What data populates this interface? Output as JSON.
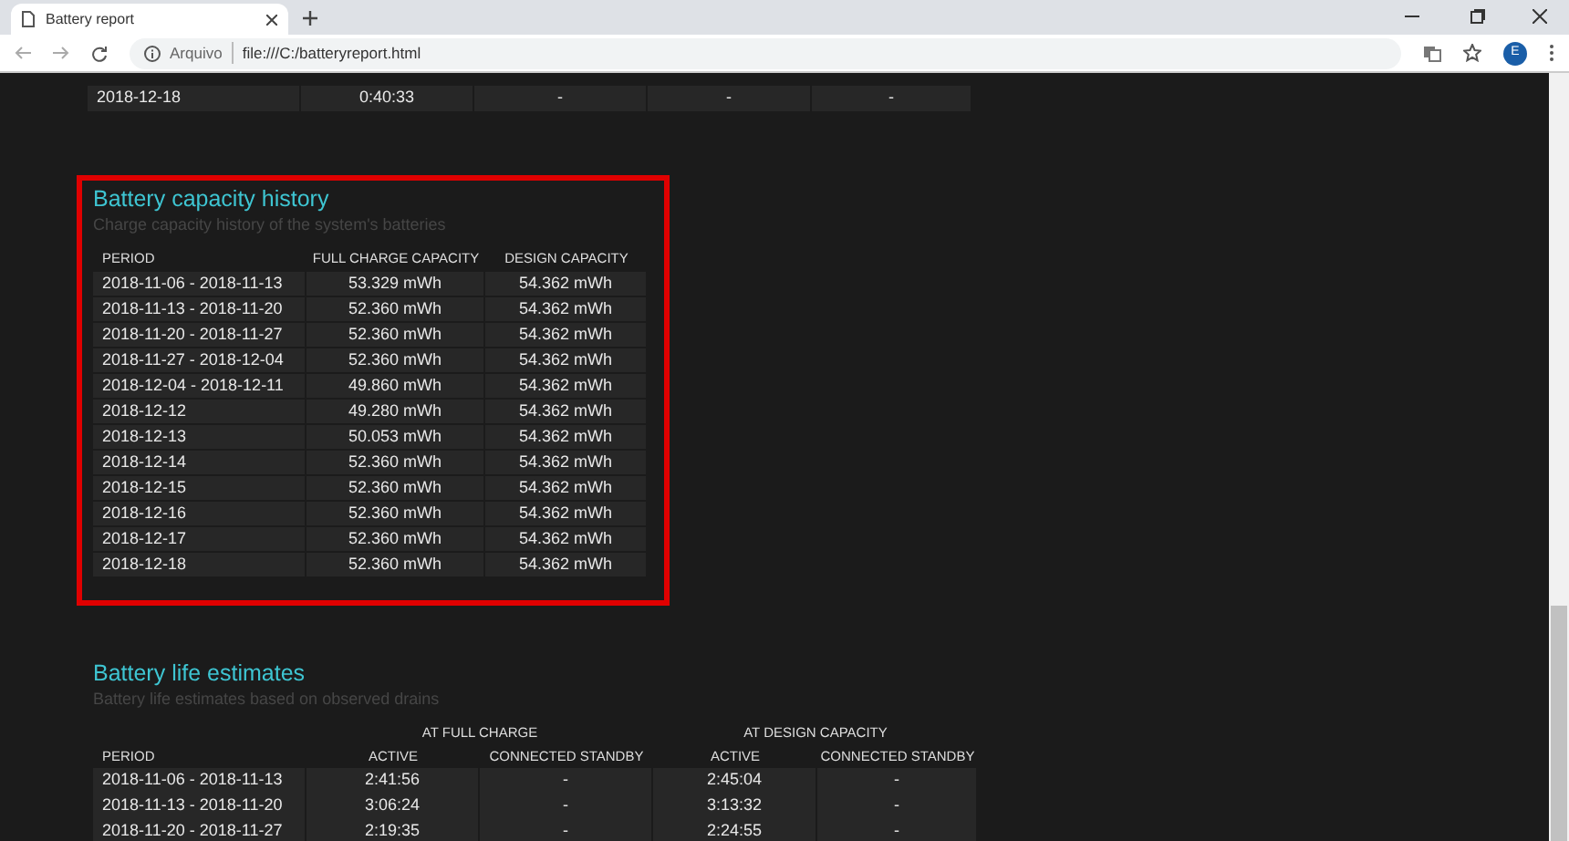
{
  "browser": {
    "tab_title": "Battery report",
    "address_prefix": "Arquivo",
    "url": "file:///C:/batteryreport.html",
    "profile_initial": "E"
  },
  "drains_table": {
    "rows": [
      [
        "2018-12-18",
        "0:40:33",
        "-",
        "-",
        "-"
      ]
    ]
  },
  "capacity_history": {
    "highlighted": true,
    "title": "Battery capacity history",
    "subtitle": "Charge capacity history of the system's batteries",
    "columns": [
      "PERIOD",
      "FULL CHARGE CAPACITY",
      "DESIGN CAPACITY"
    ],
    "rows": [
      [
        "2018-11-06 - 2018-11-13",
        "53.329 mWh",
        "54.362 mWh"
      ],
      [
        "2018-11-13 - 2018-11-20",
        "52.360 mWh",
        "54.362 mWh"
      ],
      [
        "2018-11-20 - 2018-11-27",
        "52.360 mWh",
        "54.362 mWh"
      ],
      [
        "2018-11-27 - 2018-12-04",
        "52.360 mWh",
        "54.362 mWh"
      ],
      [
        "2018-12-04 - 2018-12-11",
        "49.860 mWh",
        "54.362 mWh"
      ],
      [
        "2018-12-12",
        "49.280 mWh",
        "54.362 mWh"
      ],
      [
        "2018-12-13",
        "50.053 mWh",
        "54.362 mWh"
      ],
      [
        "2018-12-14",
        "52.360 mWh",
        "54.362 mWh"
      ],
      [
        "2018-12-15",
        "52.360 mWh",
        "54.362 mWh"
      ],
      [
        "2018-12-16",
        "52.360 mWh",
        "54.362 mWh"
      ],
      [
        "2018-12-17",
        "52.360 mWh",
        "54.362 mWh"
      ],
      [
        "2018-12-18",
        "52.360 mWh",
        "54.362 mWh"
      ]
    ]
  },
  "life_estimates": {
    "highlighted": false,
    "title": "Battery life estimates",
    "subtitle": "Battery life estimates based on observed drains",
    "column_groups": [
      "AT FULL CHARGE",
      "AT DESIGN CAPACITY"
    ],
    "columns": [
      "PERIOD",
      "ACTIVE",
      "CONNECTED STANDBY",
      "ACTIVE",
      "CONNECTED STANDBY"
    ],
    "rows": [
      [
        "2018-11-06 - 2018-11-13",
        "2:41:56",
        "-",
        "2:45:04",
        "-"
      ],
      [
        "2018-11-13 - 2018-11-20",
        "3:06:24",
        "-",
        "3:13:32",
        "-"
      ],
      [
        "2018-11-20 - 2018-11-27",
        "2:19:35",
        "-",
        "2:24:55",
        "-"
      ]
    ]
  }
}
